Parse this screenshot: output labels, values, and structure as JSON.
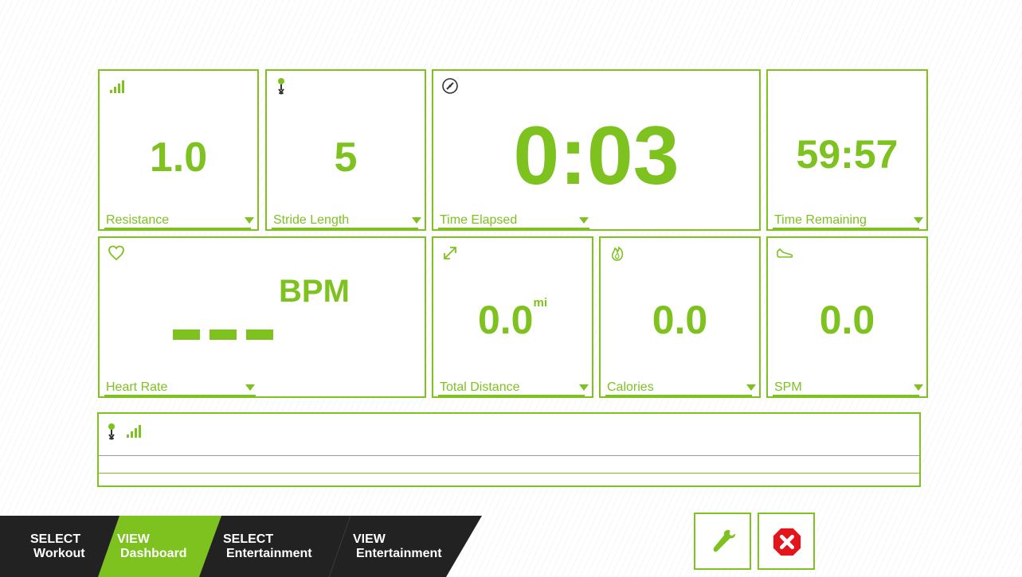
{
  "tiles": {
    "resistance": {
      "value": "1.0",
      "label": "Resistance",
      "icon": "signal-bars-icon"
    },
    "stride": {
      "value": "5",
      "label": "Stride Length",
      "icon": "stride-icon"
    },
    "elapsed": {
      "value": "0:03",
      "label": "Time Elapsed",
      "icon": "stopwatch-icon"
    },
    "remaining": {
      "value": "59:57",
      "label": "Time Remaining"
    },
    "heart": {
      "unit": "BPM",
      "label": "Heart Rate",
      "icon": "heart-icon"
    },
    "distance": {
      "value": "0.0",
      "unit": "mi",
      "label": "Total Distance",
      "icon": "expand-arrow-icon"
    },
    "calories": {
      "value": "0.0",
      "label": "Calories",
      "icon": "flame-icon"
    },
    "spm": {
      "value": "0.0",
      "label": "SPM",
      "icon": "shoe-icon"
    }
  },
  "nav": {
    "tabs": [
      {
        "top": "SELECT",
        "bottom": "Workout"
      },
      {
        "top": "VIEW",
        "bottom": "Dashboard"
      },
      {
        "top": "SELECT",
        "bottom": "Entertainment"
      },
      {
        "top": "VIEW",
        "bottom": "Entertainment"
      }
    ]
  },
  "colors": {
    "accent": "#7dc21e",
    "nav_bg": "#222222",
    "close": "#e3141b"
  }
}
